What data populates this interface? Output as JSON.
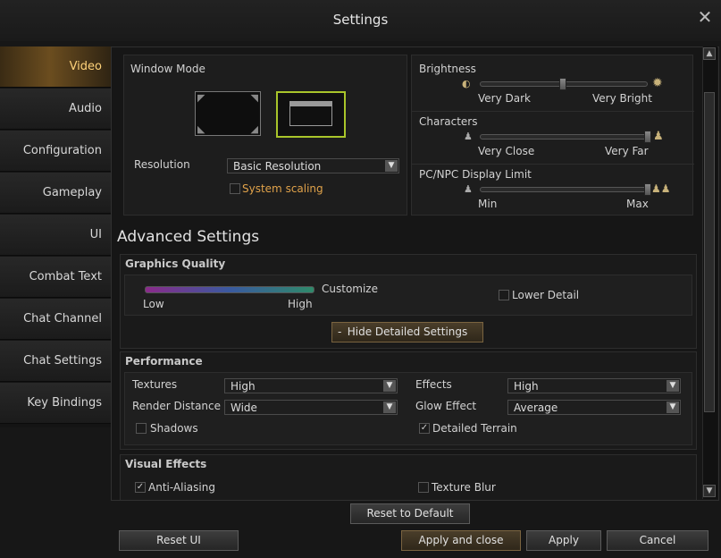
{
  "window": {
    "title": "Settings"
  },
  "sidebar": {
    "items": [
      {
        "label": "Video"
      },
      {
        "label": "Audio"
      },
      {
        "label": "Configuration"
      },
      {
        "label": "Gameplay"
      },
      {
        "label": "UI"
      },
      {
        "label": "Combat Text"
      },
      {
        "label": "Chat Channel"
      },
      {
        "label": "Chat Settings"
      },
      {
        "label": "Key Bindings"
      }
    ]
  },
  "display": {
    "window_mode_label": "Window Mode",
    "resolution_label": "Resolution",
    "resolution_value": "Basic Resolution",
    "system_scaling_label": "System scaling",
    "system_scaling_checked": false
  },
  "sliders": {
    "brightness": {
      "label": "Brightness",
      "min_label": "Very Dark",
      "max_label": "Very Bright",
      "value": 0.5
    },
    "characters": {
      "label": "Characters",
      "min_label": "Very Close",
      "max_label": "Very Far",
      "value": 1.0
    },
    "pcnpc": {
      "label": "PC/NPC Display Limit",
      "min_label": "Min",
      "max_label": "Max",
      "value": 1.0
    }
  },
  "advanced": {
    "title": "Advanced Settings",
    "graphics_quality": {
      "title": "Graphics Quality",
      "preset_label": "Customize",
      "low_label": "Low",
      "high_label": "High",
      "lower_detail_label": "Lower Detail",
      "hide_button": "Hide Detailed Settings"
    },
    "performance": {
      "title": "Performance",
      "textures": {
        "label": "Textures",
        "value": "High"
      },
      "render_distance": {
        "label": "Render Distance",
        "value": "Wide"
      },
      "effects": {
        "label": "Effects",
        "value": "High"
      },
      "glow_effect": {
        "label": "Glow Effect",
        "value": "Average"
      },
      "shadows": {
        "label": "Shadows",
        "checked": false
      },
      "detailed_terrain": {
        "label": "Detailed Terrain",
        "checked": true
      }
    },
    "visual_effects": {
      "title": "Visual Effects",
      "anti_aliasing": {
        "label": "Anti-Aliasing",
        "checked": true
      },
      "texture_blur": {
        "label": "Texture Blur",
        "checked": false
      }
    }
  },
  "buttons": {
    "reset_default": "Reset to Default",
    "reset_ui": "Reset UI",
    "apply_close": "Apply and close",
    "apply": "Apply",
    "cancel": "Cancel"
  },
  "colors": {
    "accent": "#ffd37a",
    "brightness_icon": "#d4b15a",
    "slider_gradient": [
      "#8a2a8a",
      "#2f8a6a"
    ]
  }
}
